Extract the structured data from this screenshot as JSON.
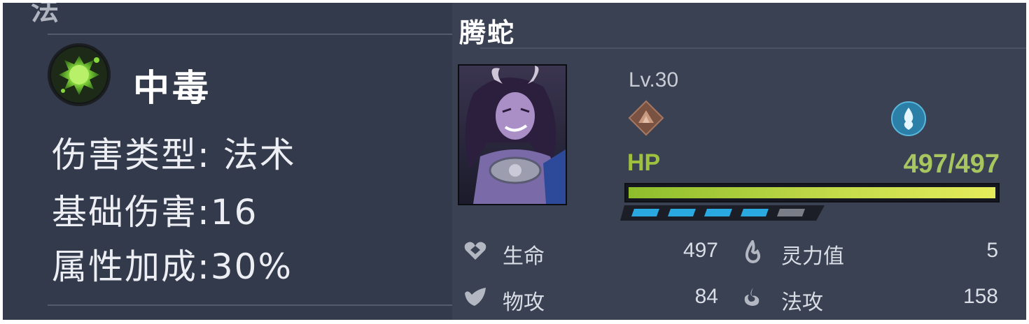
{
  "left_panel": {
    "header_partial": "法",
    "skill": {
      "name": "中毒",
      "damage_type": "伤害类型: 法术",
      "base_damage": "基础伤害:16",
      "attribute_bonus": "属性加成:30%"
    }
  },
  "right_panel": {
    "character_name": "腾蛇",
    "level": "Lv.30",
    "hp_label": "HP",
    "hp_value": "497/497",
    "hp_fraction": 1.0,
    "energy_pips": {
      "filled": 4,
      "total": 5
    },
    "element_icons": [
      "earth-element-icon",
      "water-element-icon"
    ],
    "stats": [
      {
        "icon": "heart-life-icon",
        "label": "生命",
        "value": "497"
      },
      {
        "icon": "spirit-drop-icon",
        "label": "灵力值",
        "value": "5"
      },
      {
        "icon": "fist-attack-icon",
        "label": "物攻",
        "value": "84"
      },
      {
        "icon": "magic-swirl-icon",
        "label": "法攻",
        "value": "158"
      }
    ]
  },
  "colors": {
    "left_bg": "#333a4b",
    "right_bg": "#3a4152",
    "hp_green": "#9ec23e",
    "pip_blue": "#2aa8e0"
  }
}
